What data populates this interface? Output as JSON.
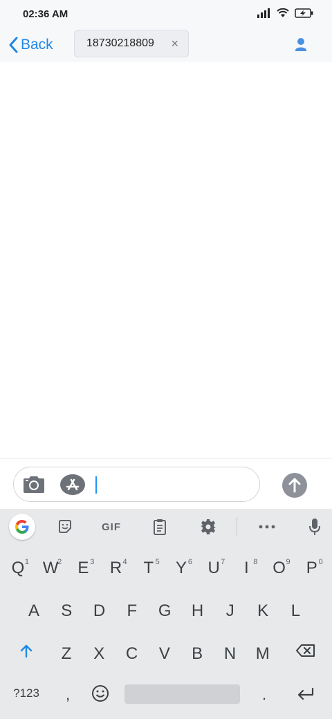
{
  "status": {
    "time": "02:36 AM"
  },
  "nav": {
    "back_label": "Back",
    "recipient": "18730218809",
    "chip_close": "×"
  },
  "toolbar": {
    "gif_label": "GIF"
  },
  "keyboard": {
    "row1": [
      {
        "k": "Q",
        "h": "1"
      },
      {
        "k": "W",
        "h": "2"
      },
      {
        "k": "E",
        "h": "3"
      },
      {
        "k": "R",
        "h": "4"
      },
      {
        "k": "T",
        "h": "5"
      },
      {
        "k": "Y",
        "h": "6"
      },
      {
        "k": "U",
        "h": "7"
      },
      {
        "k": "I",
        "h": "8"
      },
      {
        "k": "O",
        "h": "9"
      },
      {
        "k": "P",
        "h": "0"
      }
    ],
    "row2": [
      "A",
      "S",
      "D",
      "F",
      "G",
      "H",
      "J",
      "K",
      "L"
    ],
    "row3": [
      "Z",
      "X",
      "C",
      "V",
      "B",
      "N",
      "M"
    ],
    "symbols_label": "?123",
    "comma": ",",
    "period": "."
  },
  "colors": {
    "accent": "#1e88e5",
    "cursor": "#2196f3",
    "send_button": "#8e9199",
    "keyboard_bg": "#e8e9eb"
  },
  "icons": [
    "signal-icon",
    "wifi-icon",
    "battery-charging-icon",
    "chevron-left-icon",
    "person-icon",
    "camera-icon",
    "app-store-icon",
    "arrow-up-icon",
    "google-icon",
    "sticker-icon",
    "clipboard-icon",
    "gear-icon",
    "more-icon",
    "mic-icon",
    "shift-icon",
    "backspace-icon",
    "emoji-icon",
    "enter-icon"
  ]
}
